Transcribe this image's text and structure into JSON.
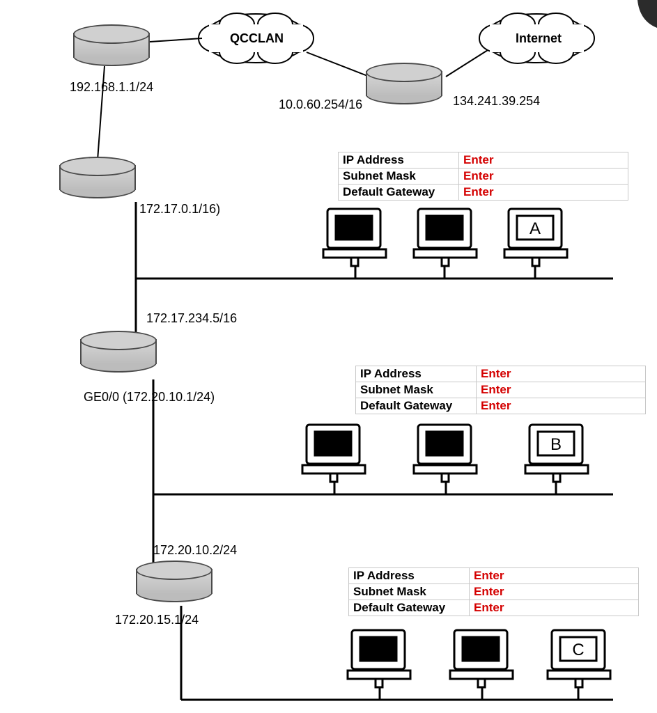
{
  "clouds": {
    "qcclan": "QCCLAN",
    "internet": "Internet"
  },
  "labels": {
    "r1_ip": "192.168.1.1/24",
    "qcc_left": "10.0.60.254/16",
    "qcc_right": "134.241.39.254",
    "r2_down": "172.17.0.1/16)",
    "r3_up": "172.17.234.5/16",
    "r3_down": "GE0/0 (172.20.10.1/24)",
    "r4_up": "172.20.10.2/24",
    "r4_down": "172.20.15.1/24"
  },
  "tables_common": {
    "row1": "IP Address",
    "row2": "Subnet Mask",
    "row3": "Default Gateway",
    "enter": "Enter"
  },
  "pc_letters": {
    "a": "A",
    "b": "B",
    "c": "C"
  }
}
